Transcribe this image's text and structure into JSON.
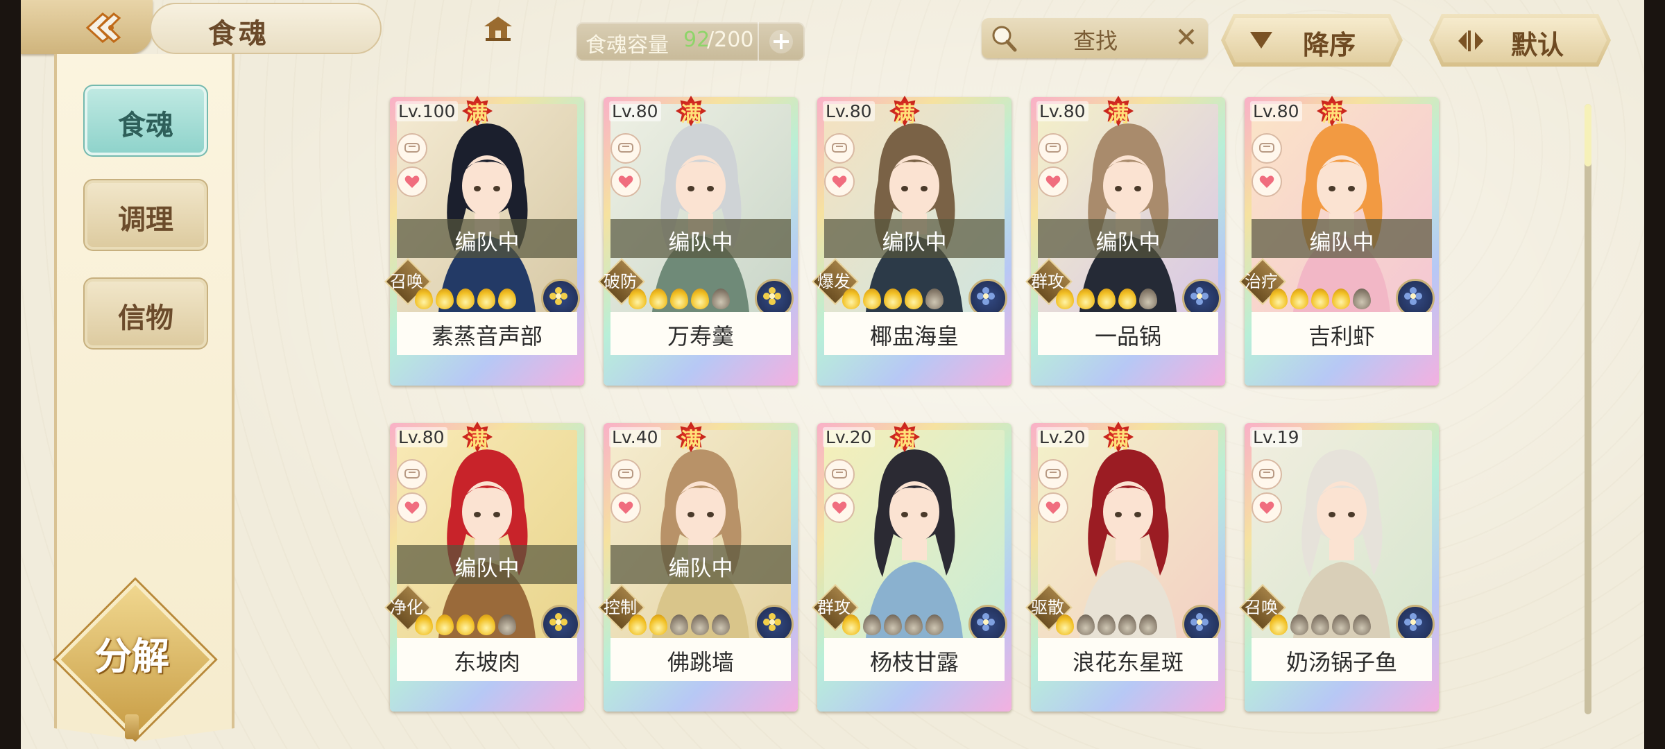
{
  "header": {
    "title": "食魂",
    "capacity": {
      "label": "食魂容量",
      "current": "92",
      "max": "/200"
    },
    "search": {
      "placeholder": "查找"
    },
    "sort_order_label": "降序",
    "sort_mode_label": "默认"
  },
  "sidebar": {
    "tabs": [
      {
        "label": "食魂",
        "active": true
      },
      {
        "label": "调理",
        "active": false
      },
      {
        "label": "信物",
        "active": false
      }
    ],
    "decompose_label": "分解"
  },
  "colors": {
    "star_on": "#f2c126",
    "star_off": "#8c8070",
    "active_tab": "#8fd3cb",
    "capacity_current": "#8fd46a",
    "full_badge": "#c9221a"
  },
  "cards": [
    {
      "level": "Lv.100",
      "full": "满",
      "status": "编队中",
      "role": "召唤",
      "name": "素蒸音声部",
      "stars_lit": 5,
      "stars_total": 5,
      "bg": [
        "#f4ead2",
        "#d7c9a6"
      ],
      "hair": "#1b1f2d",
      "coat": "#233a66",
      "emblem": "yellow-flower-icon"
    },
    {
      "level": "Lv.80",
      "full": "满",
      "status": "编队中",
      "role": "破防",
      "name": "万寿羹",
      "stars_lit": 4,
      "stars_total": 5,
      "bg": [
        "#eef0e4",
        "#c9d6c9"
      ],
      "hair": "#cfd3d6",
      "coat": "#6f8a78",
      "emblem": "yellow-flower-icon"
    },
    {
      "level": "Lv.80",
      "full": "满",
      "status": "编队中",
      "role": "爆发",
      "name": "椰盅海皇",
      "stars_lit": 4,
      "stars_total": 5,
      "bg": [
        "#f5e2c0",
        "#cfe5df"
      ],
      "hair": "#7a6246",
      "coat": "#2c3a48",
      "emblem": "blue-flower-icon"
    },
    {
      "level": "Lv.80",
      "full": "满",
      "status": "编队中",
      "role": "群攻",
      "name": "一品锅",
      "stars_lit": 4,
      "stars_total": 5,
      "bg": [
        "#f4f0c8",
        "#d8c7e6"
      ],
      "hair": "#a98b6c",
      "coat": "#252a36",
      "emblem": "blue-flower-icon"
    },
    {
      "level": "Lv.80",
      "full": "满",
      "status": "编队中",
      "role": "治疗",
      "name": "吉利虾",
      "stars_lit": 4,
      "stars_total": 5,
      "bg": [
        "#fbe4c7",
        "#f4c7d3"
      ],
      "hair": "#f29a42",
      "coat": "#f2b7c6",
      "emblem": "blue-flower-icon"
    },
    {
      "level": "Lv.80",
      "full": "满",
      "status": "编队中",
      "role": "净化",
      "name": "东坡肉",
      "stars_lit": 4,
      "stars_total": 5,
      "bg": [
        "#f8e9b6",
        "#e9d58d"
      ],
      "hair": "#c8232a",
      "coat": "#9a6a3a",
      "emblem": "yellow-flower-icon"
    },
    {
      "level": "Lv.40",
      "full": "满",
      "status": "编队中",
      "role": "控制",
      "name": "佛跳墙",
      "stars_lit": 2,
      "stars_total": 5,
      "bg": [
        "#f5eccf",
        "#e4d3a2"
      ],
      "hair": "#b89268",
      "coat": "#d9c58a",
      "emblem": "yellow-flower-icon"
    },
    {
      "level": "Lv.20",
      "full": "满",
      "status": "",
      "role": "群攻",
      "name": "杨枝甘露",
      "stars_lit": 1,
      "stars_total": 5,
      "bg": [
        "#f6efb9",
        "#c9ecd6"
      ],
      "hair": "#2b2a33",
      "coat": "#8ab1cf",
      "emblem": "blue-flower-icon"
    },
    {
      "level": "Lv.20",
      "full": "满",
      "status": "",
      "role": "驱散",
      "name": "浪花东星斑",
      "stars_lit": 1,
      "stars_total": 5,
      "bg": [
        "#f3f1c9",
        "#f3d0c4"
      ],
      "hair": "#9b1c23",
      "coat": "#e8e2d5",
      "emblem": "blue-flower-icon"
    },
    {
      "level": "Lv.19",
      "full": "",
      "status": "",
      "role": "召唤",
      "name": "奶汤锅子鱼",
      "stars_lit": 1,
      "stars_total": 5,
      "bg": [
        "#f1eedf",
        "#d7e6cf"
      ],
      "hair": "#e6e2da",
      "coat": "#d9cfb8",
      "emblem": "blue-flower-icon"
    }
  ]
}
